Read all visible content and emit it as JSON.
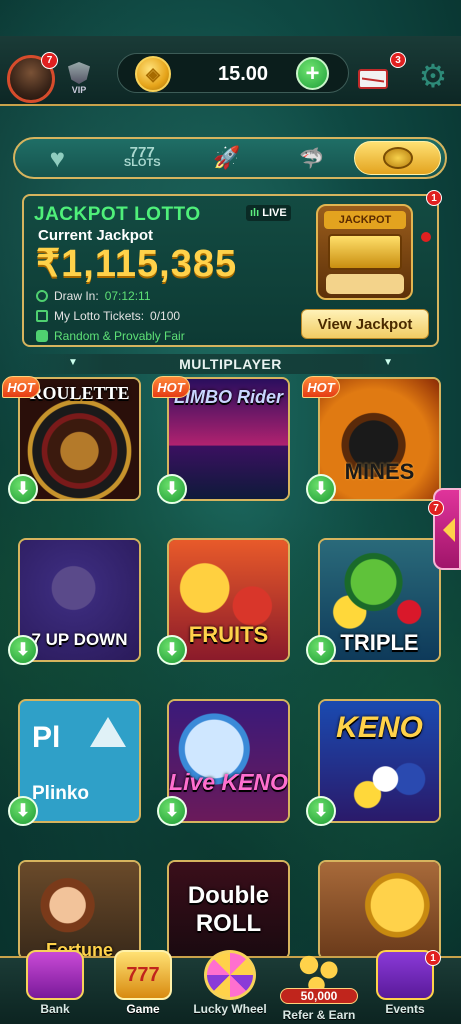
{
  "header": {
    "avatar_badge": "7",
    "vip_label": "VIP",
    "balance": "15.00",
    "add_label": "+",
    "mail_badge": "3"
  },
  "tabs": [
    {
      "name": "favorites",
      "label": ""
    },
    {
      "name": "slots",
      "label": "SLOTS",
      "sub": "777"
    },
    {
      "name": "crash",
      "label": ""
    },
    {
      "name": "fishing",
      "label": ""
    },
    {
      "name": "lotto",
      "label": "",
      "active": true
    }
  ],
  "jackpot": {
    "title": "JACKPOT LOTTO",
    "live": "LIVE",
    "current_label": "Current Jackpot",
    "amount": "₹1,115,385",
    "draw_label": "Draw In:",
    "draw_time": "07:12:11",
    "tickets_label": "My Lotto Tickets:",
    "tickets_value": "0/100",
    "fair_label": "Random & Provably Fair",
    "machine_label": "JACKPOT",
    "view_button": "View Jackpot",
    "badge": "1"
  },
  "section": {
    "title": "MULTIPLAYER"
  },
  "games": [
    {
      "name": "ROULETTE",
      "hot": "HOT"
    },
    {
      "name": "LIMBO Rider",
      "hot": "HOT"
    },
    {
      "name": "MINES",
      "hot": "HOT"
    },
    {
      "name": "7 UP DOWN"
    },
    {
      "name": "FRUITS"
    },
    {
      "name": "TRIPLE"
    },
    {
      "name": "Plinko",
      "short": "Pl"
    },
    {
      "name": "Live KENO"
    },
    {
      "name": "KENO"
    },
    {
      "name": "Fortune"
    },
    {
      "name": "Double ROLL"
    },
    {
      "name": ""
    }
  ],
  "side_badge": "7",
  "bottom_nav": {
    "bank": "Bank",
    "game": "Game",
    "lucky_wheel": "Lucky Wheel",
    "refer": "Refer & Earn",
    "refer_amount": "50,000",
    "events": "Events",
    "events_badge": "1"
  },
  "colors": {
    "gold_border": "#d6b45e",
    "jackpot_green": "#4ff07a",
    "jackpot_amount": "#ffd24a",
    "download_green": "#1d9a34"
  }
}
